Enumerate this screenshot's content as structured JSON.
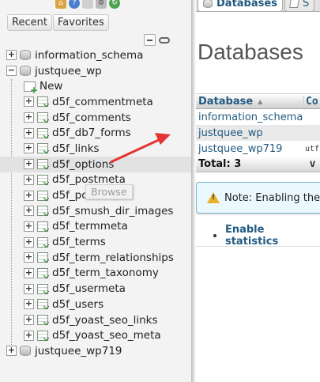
{
  "navigation": {
    "toolbar_icons": [
      "home-icon",
      "help-icon",
      "docs-icon",
      "settings-icon",
      "reload-icon"
    ],
    "tabs": {
      "recent": "Recent",
      "favorites": "Favorites"
    },
    "tree": {
      "databases": [
        {
          "name": "information_schema",
          "expanded": false
        },
        {
          "name": "justquee_wp",
          "expanded": true,
          "new_label": "New",
          "tables": [
            "d5f_commentmeta",
            "d5f_comments",
            "d5f_db7_forms",
            "d5f_links",
            "d5f_options",
            "d5f_postmeta",
            "d5f_posts",
            "d5f_smush_dir_images",
            "d5f_termmeta",
            "d5f_terms",
            "d5f_term_relationships",
            "d5f_term_taxonomy",
            "d5f_usermeta",
            "d5f_users",
            "d5f_yoast_seo_links",
            "d5f_yoast_seo_meta"
          ]
        },
        {
          "name": "justquee_wp719",
          "expanded": false
        }
      ]
    },
    "hovered_table": "d5f_options",
    "tooltip": "Browse"
  },
  "main": {
    "tabs": [
      {
        "label": "Databases",
        "active": true
      },
      {
        "label": "S",
        "active": false
      }
    ],
    "heading": "Databases",
    "table": {
      "headers": [
        "Database",
        "Co"
      ],
      "rows": [
        {
          "name": "information_schema",
          "collation": ""
        },
        {
          "name": "justquee_wp",
          "collation": ""
        },
        {
          "name": "justquee_wp719",
          "collation": "utf"
        }
      ],
      "total_label": "Total: 3",
      "total_extra": "v"
    },
    "notice": "Note: Enabling the d",
    "enable_stats": "Enable statistics"
  },
  "colors": {
    "link": "#235a81",
    "annotation_arrow": "#e53333",
    "notice_bg": "#ebf8fd",
    "warning": "#e8b12a"
  }
}
